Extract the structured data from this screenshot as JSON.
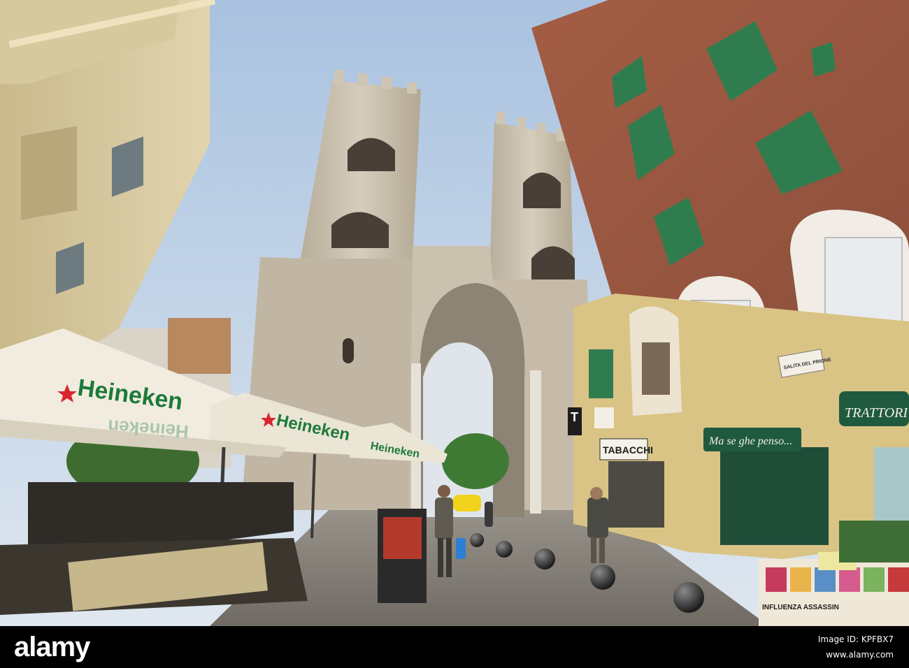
{
  "signs": {
    "heineken": "Heineken",
    "tabacchi": "TABACCHI",
    "shop": "Ma se ghe penso...",
    "trattoria": "TRATTORI",
    "street": "SALITA DEL PRIONE",
    "tobacco_t": "T",
    "magazine": "INFLUENZA ASSASSIN"
  },
  "footer": {
    "logo": "alamy",
    "image_id": "Image ID: KPFBX7",
    "site": "www.alamy.com"
  },
  "colors": {
    "sky": "#b8cde4",
    "stone": "#c9bfae",
    "brick": "#9a5a44",
    "shutter": "#2f7d4f",
    "umbrella": "#f1ecdf",
    "heineken_green": "#1d7a3a"
  }
}
